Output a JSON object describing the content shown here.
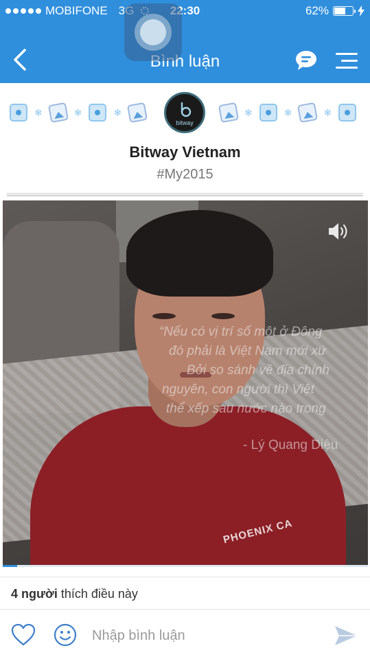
{
  "status_bar": {
    "carrier": "MOBIFONE",
    "network": "3G",
    "time": "22:30",
    "battery_percent_text": "62%",
    "battery_level": 0.62
  },
  "nav": {
    "title": "Bình luận",
    "back_icon": "chevron-left-icon",
    "chat_icon": "chat-bubble-icon",
    "menu_icon": "menu-lines-icon"
  },
  "header": {
    "logo_text": "bitway",
    "title": "Bitway Vietnam",
    "hashtag": "#My2015"
  },
  "video": {
    "quote_lines": [
      "“Nếu có vị trí số một ở Đông",
      "đó phải là Việt Nam mới xứ",
      "Bởi so sánh về địa chính",
      "nguyên, con người thì Việt",
      "thể xếp sau nước nào trong"
    ],
    "quote_author": "- Lý Quang Diệu",
    "shirt_text": "PHOENIX CA",
    "sound_icon": "speaker-icon",
    "progress": 0.04
  },
  "likes": {
    "count_text": "4 người",
    "suffix_text": " thích điều này"
  },
  "comment_bar": {
    "placeholder": "Nhập bình luận",
    "value": ""
  },
  "colors": {
    "brand_blue": "#2f8fdd",
    "text_dark": "#222222",
    "text_muted": "#777777"
  }
}
